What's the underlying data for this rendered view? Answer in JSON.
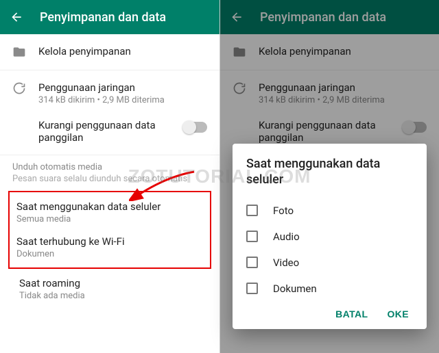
{
  "accent": "#008069",
  "header": {
    "title": "Penyimpanan dan data"
  },
  "items": {
    "manage": {
      "label": "Kelola penyimpanan"
    },
    "network": {
      "label": "Penggunaan jaringan",
      "sub": "314 kB dikirim • 2,9 MB diterima"
    },
    "reduceCall": {
      "label": "Kurangi penggunaan data panggilan"
    }
  },
  "section": {
    "title": "Unduh otomatis media",
    "sub": "Pesan suara selalu diunduh secara otomatis"
  },
  "autoDownload": {
    "cellular": {
      "label": "Saat menggunakan data seluler",
      "value": "Semua media"
    },
    "wifi": {
      "label": "Saat terhubung ke Wi-Fi",
      "value": "Dokumen"
    },
    "roaming": {
      "label": "Saat roaming",
      "value": "Tidak ada media"
    }
  },
  "dialog": {
    "title": "Saat menggunakan data seluler",
    "options": {
      "photo": "Foto",
      "audio": "Audio",
      "video": "Video",
      "doc": "Dokumen"
    },
    "cancel": "BATAL",
    "ok": "OKE"
  },
  "watermark": "ZOTUTORIAL.COM"
}
